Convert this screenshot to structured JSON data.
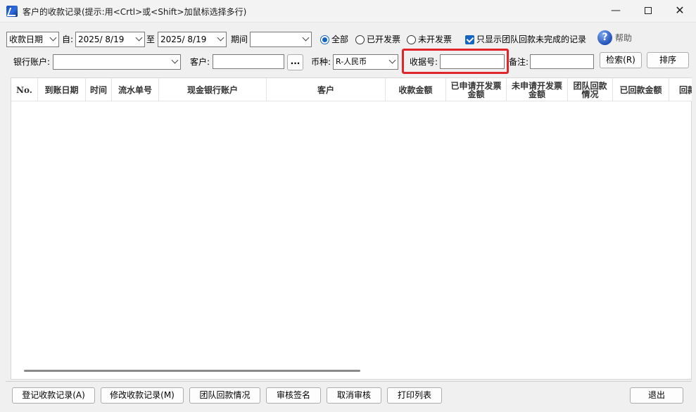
{
  "window": {
    "title": "客户的收款记录(提示:用<Crtl>或<Shift>加鼠标选择多行)",
    "minimize": "—",
    "close": "✕"
  },
  "filters": {
    "date_type": "收款日期",
    "from_label": "自:",
    "from_date": "2025/  8/19",
    "to_label": "至",
    "to_date": "2025/  8/19",
    "period_label": "期间",
    "period_value": "",
    "radio_all": "全部",
    "radio_invoiced": "已开发票",
    "radio_not_invoiced": "未开发票",
    "selected_radio": "全部",
    "only_team_label": "只显示团队回款未完成的记录",
    "only_team_checked": true,
    "help": "帮助",
    "bank_label": "银行账户:",
    "bank_value": "",
    "customer_label": "客户:",
    "customer_value": "",
    "ellipsis": "...",
    "currency_label": "币种:",
    "currency_value": "R-人民币",
    "receipt_label": "收据号:",
    "receipt_value": "",
    "note_label": "备注:",
    "note_value": "",
    "search_button": "检索(R)",
    "sort_button": "排序"
  },
  "grid": {
    "columns": [
      "No.",
      "到账日期",
      "时间",
      "流水单号",
      "现金银行账户",
      "客户",
      "收款金额",
      "已申请开发票\n金额",
      "未申请开发票\n金额",
      "团队回款\n情况",
      "已回款金额",
      "回款"
    ],
    "rows": []
  },
  "buttons": {
    "register": "登记收款记录(A)",
    "modify": "修改收款记录(M)",
    "team": "团队回款情况",
    "approve_sign": "审核签名",
    "cancel_approve": "取消审核",
    "print": "打印列表",
    "exit": "退出"
  },
  "colors": {
    "highlight": "#e0262b",
    "accent": "#1565c0"
  }
}
